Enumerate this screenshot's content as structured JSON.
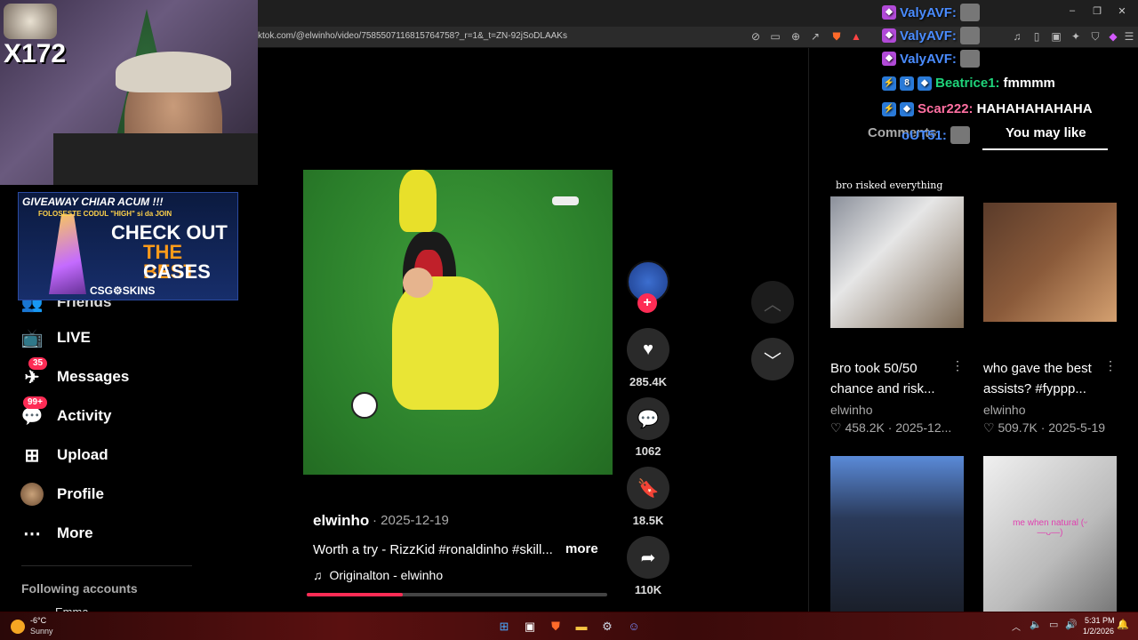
{
  "browser": {
    "url": "ktok.com/@elwinho/video/7585507116815764758?_r=1&_t=ZN-92jSoDLAAKs"
  },
  "webcam": {
    "counter": "X172"
  },
  "promo": {
    "line1": "GIVEAWAY CHIAR ACUM !!!",
    "line2": "FOLOSESTE CODUL \"HIGH\" si da JOIN",
    "line3": "CHECK OUT",
    "line4": "THE BEST",
    "line5": "CASES",
    "brand": "CSG⚙SKINS"
  },
  "sidebar": {
    "partial_item": "Friends",
    "items": [
      {
        "label": "LIVE",
        "icon": "live-tv-icon",
        "badge": ""
      },
      {
        "label": "Messages",
        "icon": "messages-icon",
        "badge": "35"
      },
      {
        "label": "Activity",
        "icon": "activity-icon",
        "badge": "99+"
      },
      {
        "label": "Upload",
        "icon": "upload-icon",
        "badge": ""
      },
      {
        "label": "Profile",
        "icon": "profile-avatar",
        "badge": ""
      },
      {
        "label": "More",
        "icon": "more-dots-icon",
        "badge": ""
      }
    ],
    "following_header": "Following accounts",
    "following_partial": "Emma"
  },
  "video": {
    "author": "elwinho",
    "date": "· 2025-12-19",
    "description": "Worth a try - RizzKid #ronaldinho #skill...",
    "more": "more",
    "music": "Originalton - elwinho",
    "progress": 0.32
  },
  "actions": {
    "likes": "285.4K",
    "comments": "1062",
    "saves": "18.5K",
    "shares": "110K"
  },
  "right_panel": {
    "tab_comments": "Comments",
    "tab_you_may_like": "You may like",
    "cards": [
      {
        "overlay": "bro risked everything",
        "title": "Bro took 50/50 chance and risk...",
        "author": "elwinho",
        "stats": "♡ 458.2K · 2025-12..."
      },
      {
        "overlay": "",
        "title": "who gave the best assists? #fyppp...",
        "author": "elwinho",
        "stats": "♡ 509.7K · 2025-5-19"
      },
      {
        "overlay": "",
        "title": "",
        "author": "",
        "stats": ""
      },
      {
        "overlay": "me when natural (ᵕ—ᴗ—)",
        "title": "",
        "author": "",
        "stats": ""
      }
    ]
  },
  "chat": [
    {
      "user": "ValyAVF:",
      "color": "#4a8cff",
      "message": ""
    },
    {
      "user": "ValyAVF:",
      "color": "#4a8cff",
      "message": ""
    },
    {
      "user": "ValyAVF:",
      "color": "#4a8cff",
      "message": ""
    },
    {
      "user": "Beatrice1:",
      "color": "#1fd37a",
      "message": "fmmmm"
    },
    {
      "user": "Scar222:",
      "color": "#ff6fa1",
      "message": "HAHAHAHAHAHA"
    },
    {
      "user": "oUT51:",
      "color": "#4a8cff",
      "message": ""
    }
  ],
  "taskbar": {
    "weather_temp": "-6°C",
    "weather_desc": "Sunny",
    "time": "5:31 PM",
    "date": "1/2/2026"
  }
}
